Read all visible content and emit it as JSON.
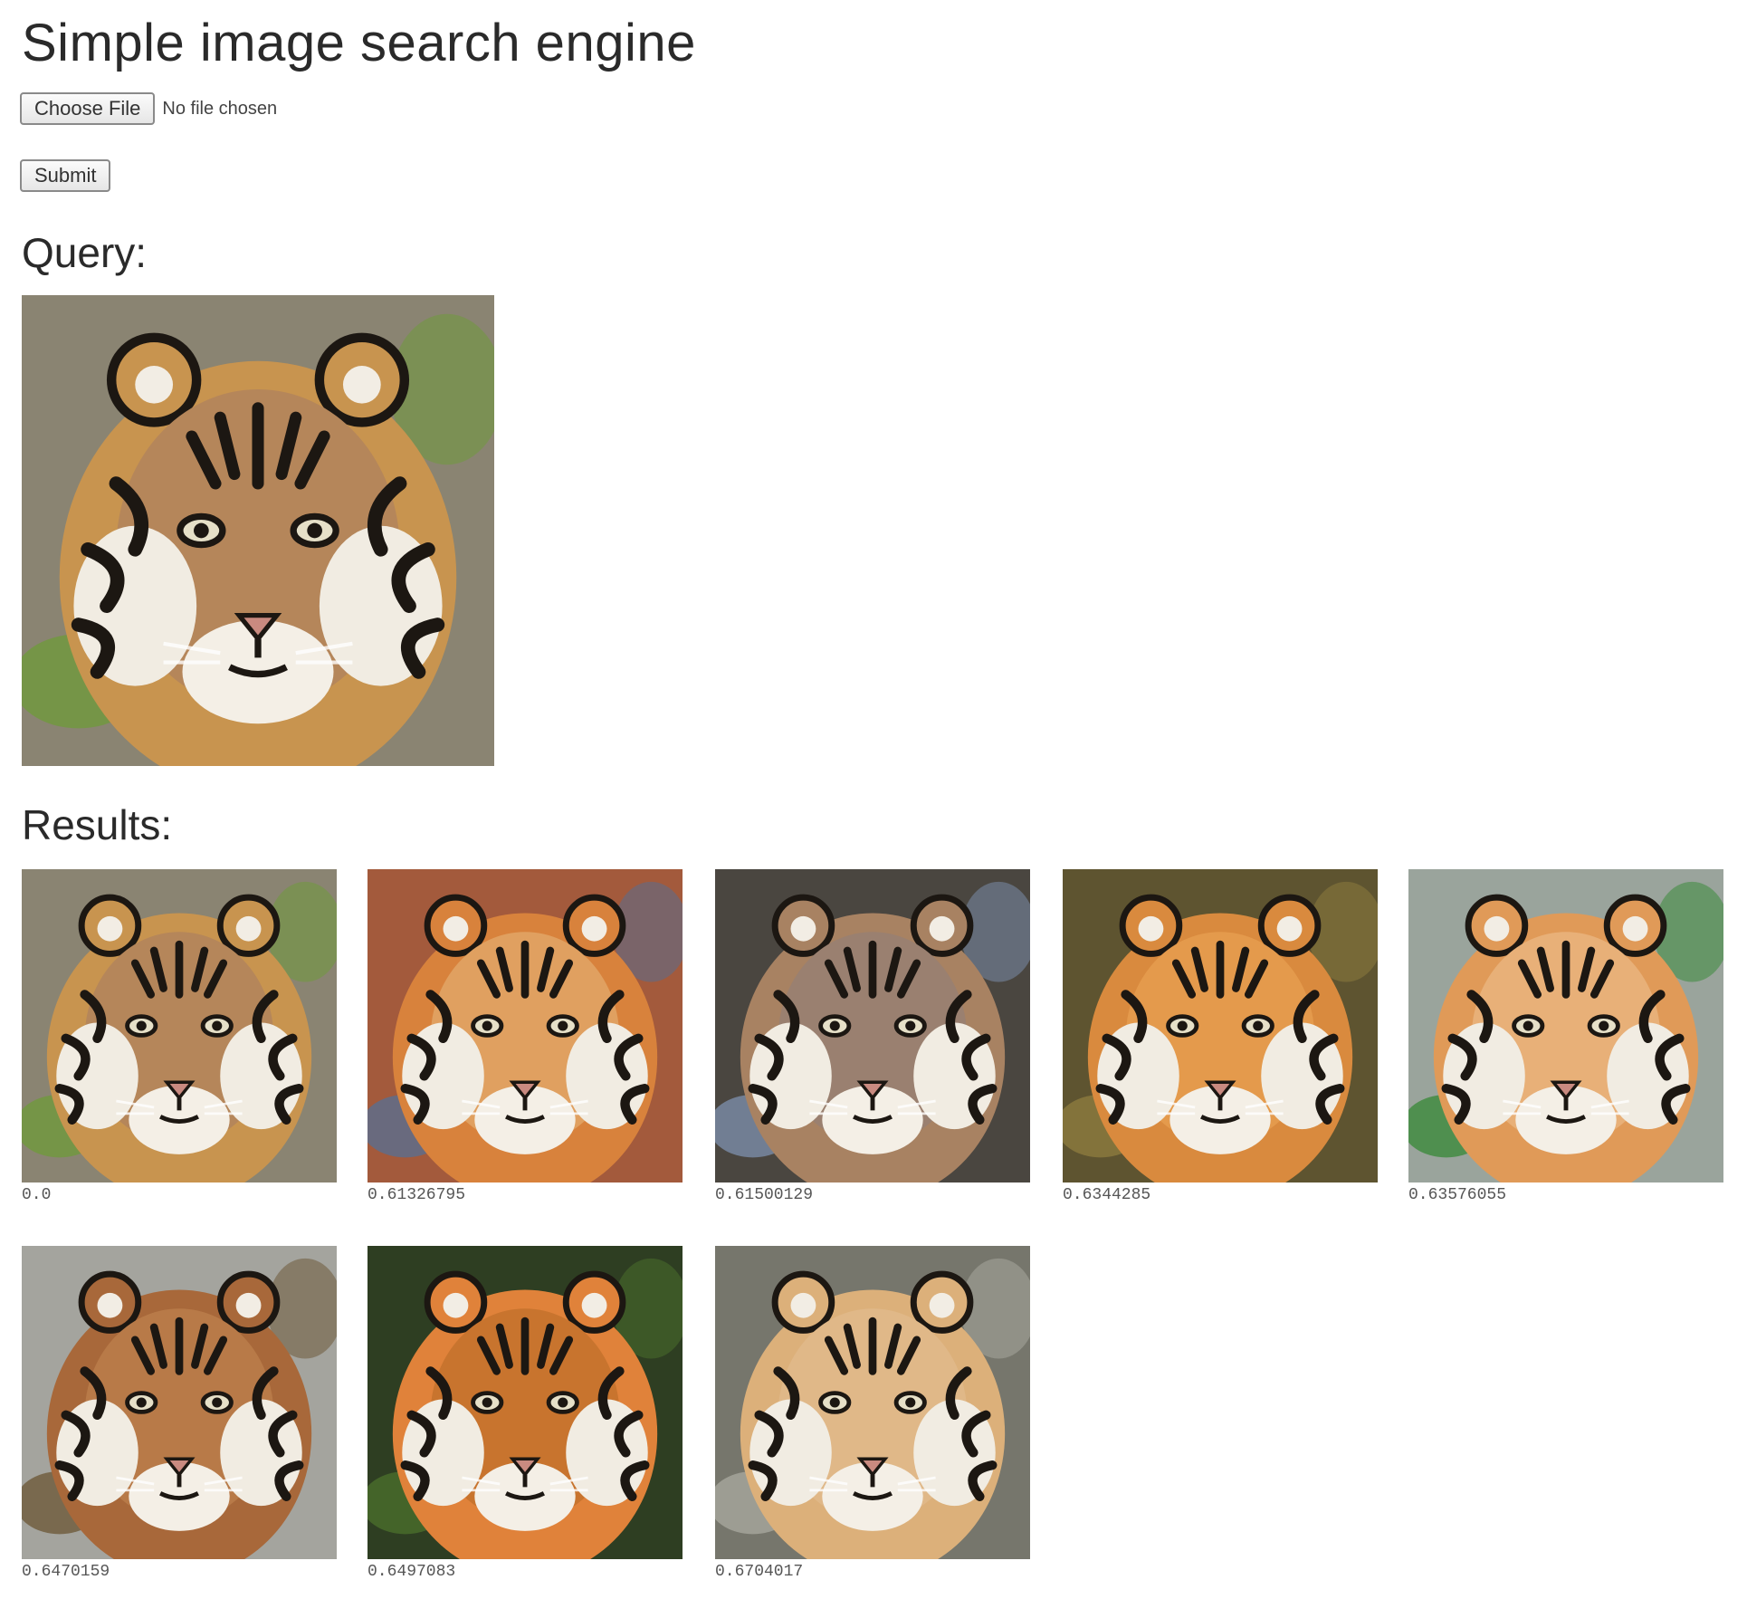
{
  "page": {
    "title": "Simple image search engine"
  },
  "upload": {
    "choose_button_label": "Choose File",
    "file_status": "No file chosen"
  },
  "submit": {
    "label": "Submit"
  },
  "query": {
    "heading": "Query:",
    "image": {
      "fur": "#c8944f",
      "face": "#b5865a",
      "bg": "#8a8472",
      "accent": "#6f9a3c"
    }
  },
  "results": {
    "heading": "Results:",
    "items": [
      {
        "score": "0.0",
        "fur": "#c8944f",
        "face": "#b5865a",
        "bg": "#8a8472",
        "accent": "#6f9a3c"
      },
      {
        "score": "0.61326795",
        "fur": "#d8823c",
        "face": "#e0a060",
        "bg": "#a35a3c",
        "accent": "#5a6e8e"
      },
      {
        "score": "0.61500129",
        "fur": "#a88262",
        "face": "#9a8070",
        "bg": "#4a4640",
        "accent": "#7a8ca8"
      },
      {
        "score": "0.6344285",
        "fur": "#d98a3e",
        "face": "#e49a4c",
        "bg": "#5e5430",
        "accent": "#8c7a3e"
      },
      {
        "score": "0.63576055",
        "fur": "#e09a58",
        "face": "#e8b078",
        "bg": "#9aa49c",
        "accent": "#3c8a3c"
      },
      {
        "score": "0.6470159",
        "fur": "#a8683a",
        "face": "#b87a48",
        "bg": "#a4a49e",
        "accent": "#6e5a3a"
      },
      {
        "score": "0.6497083",
        "fur": "#e0823a",
        "face": "#c8742e",
        "bg": "#2e3e22",
        "accent": "#4a6e2c"
      },
      {
        "score": "0.6704017",
        "fur": "#dcb07a",
        "face": "#e0b888",
        "bg": "#76766c",
        "accent": "#a8a89e"
      }
    ]
  }
}
